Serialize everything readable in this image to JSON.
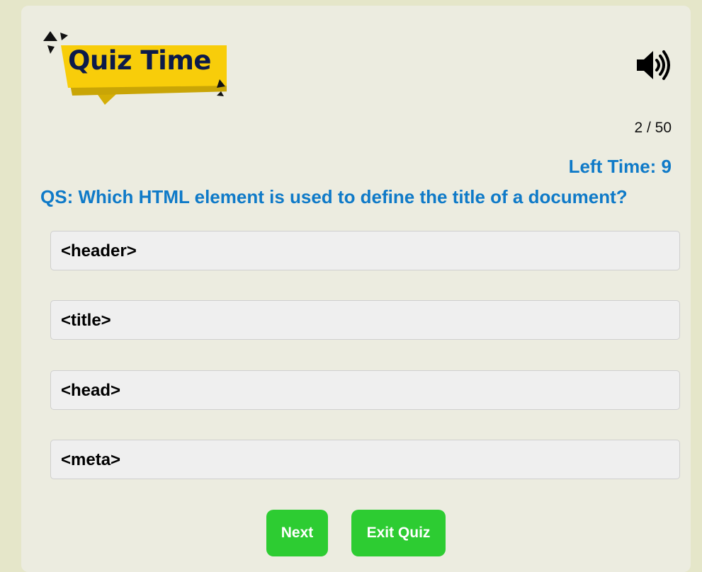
{
  "header": {
    "logo_text": "Quiz Time",
    "sound_icon": "speaker-volume-icon"
  },
  "progress": {
    "counter": "2 / 50",
    "current": 2,
    "total": 50
  },
  "timer": {
    "label": "Left Time: 9"
  },
  "question": {
    "text": "QS: Which HTML element is used to define the title of a document?"
  },
  "options": [
    {
      "label": "<header>"
    },
    {
      "label": "<title>"
    },
    {
      "label": "<head>"
    },
    {
      "label": "<meta>"
    }
  ],
  "buttons": {
    "next": "Next",
    "exit": "Exit Quiz"
  },
  "colors": {
    "accent_blue": "#0f7ac8",
    "button_green": "#2dcc32",
    "logo_yellow": "#f8cd0a",
    "logo_text": "#0c1a4a"
  }
}
